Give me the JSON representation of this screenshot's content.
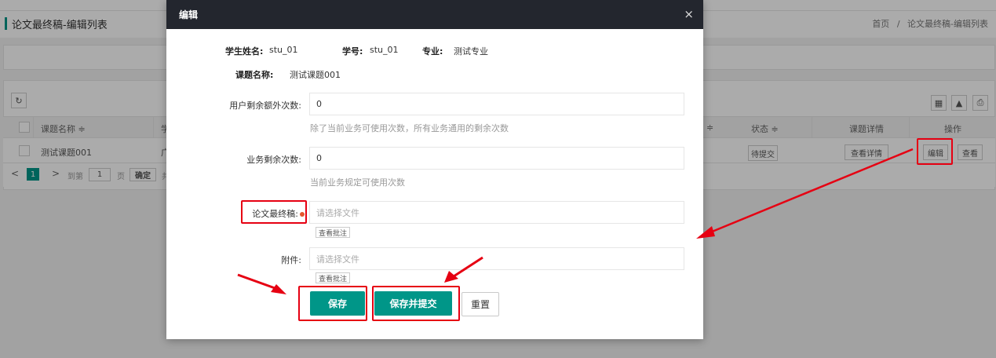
{
  "page": {
    "title": "论文最终稿-编辑列表",
    "breadcrumb": [
      "首页",
      "/",
      "论文最终稿-编辑列表"
    ],
    "table": {
      "headers": [
        "课题名称 ≑",
        "学",
        "≑",
        "状态 ≑",
        "课题详情",
        "操作"
      ],
      "row": {
        "topic": "测试课题001",
        "partial": "广",
        "status": "待提交",
        "detail_button": "查看详情",
        "edit_button": "编辑",
        "view_button": "查看"
      }
    },
    "pager": {
      "prev": "<",
      "current": "1",
      "next": ">",
      "goto_label": "到第",
      "page_input": "1",
      "page_unit": "页",
      "confirm": "确定",
      "total_partial": "共"
    },
    "toolbar_icons": [
      "refresh-icon",
      "columns-icon",
      "export-icon",
      "print-icon"
    ]
  },
  "modal": {
    "title": "编辑",
    "close": "×",
    "student_name_label": "学生姓名:",
    "student_name_value": "stu_01",
    "student_id_label": "学号:",
    "student_id_value": "stu_01",
    "major_label": "专业:",
    "major_value": "测试专业",
    "topic_label": "课题名称:",
    "topic_value": "测试课题001",
    "extra_count_label": "用户剩余额外次数:",
    "extra_count_value": "0",
    "extra_count_hint": "除了当前业务可使用次数，所有业务通用的剩余次数",
    "business_count_label": "业务剩余次数:",
    "business_count_value": "0",
    "business_count_hint": "当前业务规定可使用次数",
    "final_paper_label": "论文最终稿:",
    "final_paper_placeholder": "请选择文件",
    "view_annotation": "查看批注",
    "attachment_label": "附件:",
    "attachment_placeholder": "请选择文件",
    "view_annotation_2": "查看批注",
    "save_button": "保存",
    "save_submit_button": "保存并提交",
    "reset_button": "重置"
  },
  "colors": {
    "accent": "#009688",
    "header_dark": "#23262e",
    "highlight_red": "#e60012"
  }
}
